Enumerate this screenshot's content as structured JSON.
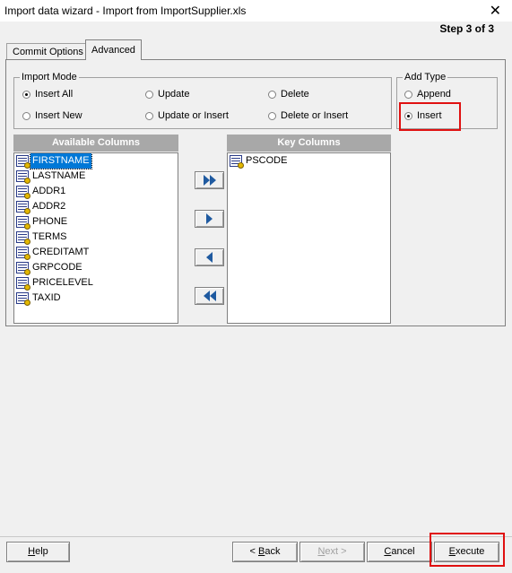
{
  "window": {
    "title": "Import data wizard - Import from ImportSupplier.xls",
    "close_glyph": "✕",
    "step": "Step 3 of 3"
  },
  "tabs": [
    {
      "label": "Commit Options",
      "active": false
    },
    {
      "label": "Advanced",
      "active": true
    }
  ],
  "import_mode": {
    "legend": "Import Mode",
    "options": [
      {
        "label": "Insert All",
        "selected": true
      },
      {
        "label": "Update",
        "selected": false
      },
      {
        "label": "Delete",
        "selected": false
      },
      {
        "label": "Insert New",
        "selected": false
      },
      {
        "label": "Update or Insert",
        "selected": false
      },
      {
        "label": "Delete or Insert",
        "selected": false
      }
    ]
  },
  "add_type": {
    "legend": "Add Type",
    "options": [
      {
        "label": "Append",
        "selected": false
      },
      {
        "label": "Insert",
        "selected": true
      }
    ]
  },
  "available_columns": {
    "header": "Available Columns",
    "items": [
      "FIRSTNAME",
      "LASTNAME",
      "ADDR1",
      "ADDR2",
      "PHONE",
      "TERMS",
      "CREDITAMT",
      "GRPCODE",
      "PRICELEVEL",
      "TAXID"
    ],
    "selected_index": 0
  },
  "key_columns": {
    "header": "Key Columns",
    "items": [
      "PSCODE"
    ]
  },
  "move_buttons": {
    "add_all_icon": "double-right-arrow-icon",
    "add_icon": "right-arrow-icon",
    "remove_icon": "left-arrow-icon",
    "remove_all_icon": "double-left-arrow-icon"
  },
  "footer": {
    "help": {
      "before": "",
      "hot": "H",
      "after": "elp"
    },
    "back": {
      "before": "< ",
      "hot": "B",
      "after": "ack"
    },
    "next": {
      "before": "",
      "hot": "N",
      "after": "ext >",
      "enabled": false
    },
    "cancel": {
      "before": "",
      "hot": "C",
      "after": "ancel"
    },
    "execute": {
      "before": "",
      "hot": "E",
      "after": "xecute"
    }
  },
  "colors": {
    "highlight": "#e01010",
    "selection": "#0078d7",
    "list_header": "#a8a8a8"
  }
}
